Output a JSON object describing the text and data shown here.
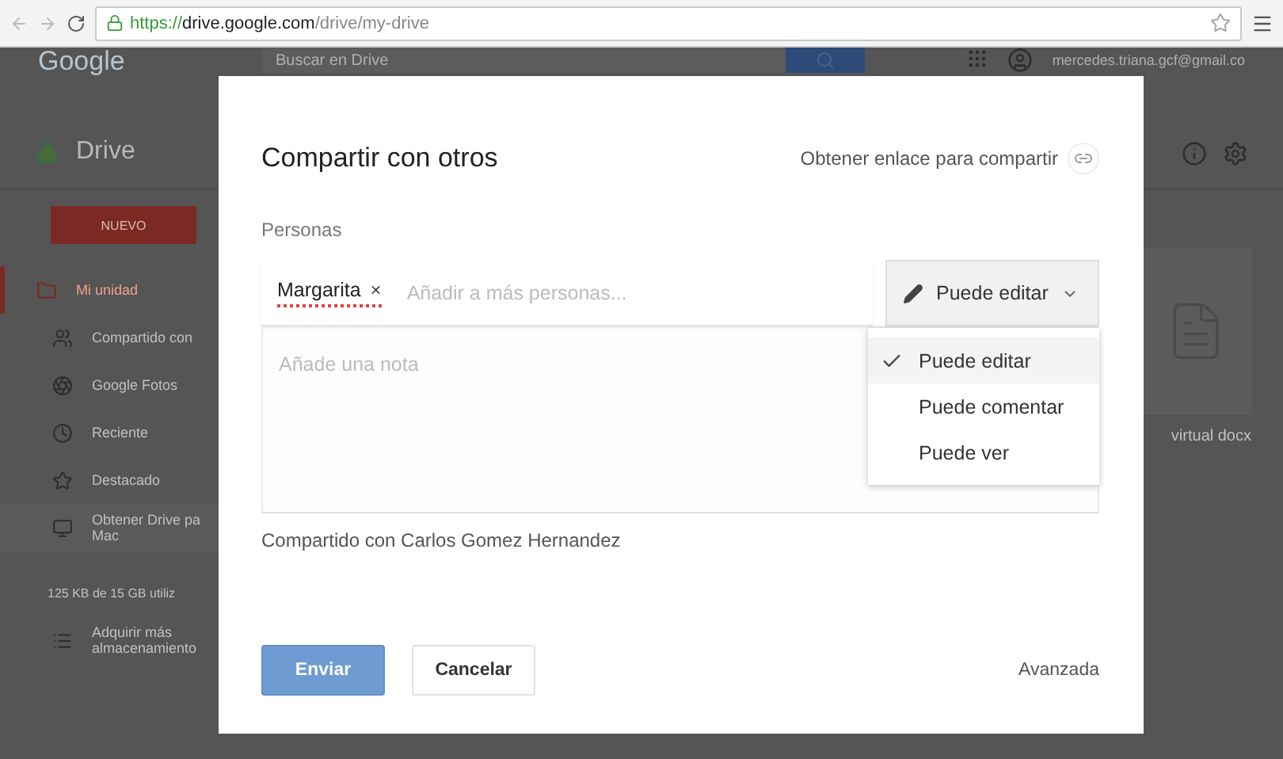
{
  "browser": {
    "scheme": "https://",
    "host": "drive.google.com",
    "path": "/drive/my-drive"
  },
  "header": {
    "logo": "Google",
    "search_placeholder": "Buscar en Drive",
    "account": "mercedes.triana.gcf@gmail.co"
  },
  "app": {
    "title": "Drive",
    "new_button": "NUEVO"
  },
  "sidebar": {
    "items": [
      {
        "kind": "folder",
        "label": "Mi unidad",
        "selected": true
      },
      {
        "kind": "people",
        "label": "Compartido con",
        "selected": false
      },
      {
        "kind": "photos",
        "label": "Google Fotos",
        "selected": false
      },
      {
        "kind": "clock",
        "label": "Reciente",
        "selected": false
      },
      {
        "kind": "star",
        "label": "Destacado",
        "selected": false
      },
      {
        "kind": "monitor",
        "label": "Obtener Drive pa\nMac",
        "selected": false
      }
    ],
    "storage": "125 KB de 15 GB utiliz",
    "upgrade": "Adquirir más\nalmacenamiento"
  },
  "file": {
    "name": "virtual docx"
  },
  "dialog": {
    "title": "Compartir con otros",
    "link_label": "Obtener enlace para compartir",
    "people_label": "Personas",
    "recipients": [
      {
        "name": "Margarita",
        "remove": "×"
      }
    ],
    "add_placeholder": "Añadir a más personas...",
    "permission": "Puede editar",
    "menu": [
      {
        "label": "Puede editar",
        "selected": true
      },
      {
        "label": "Puede comentar",
        "selected": false
      },
      {
        "label": "Puede ver",
        "selected": false
      }
    ],
    "note_placeholder": "Añade una nota",
    "shared_with": "Compartido con Carlos Gomez Hernandez",
    "send": "Enviar",
    "cancel": "Cancelar",
    "advanced": "Avanzada"
  }
}
